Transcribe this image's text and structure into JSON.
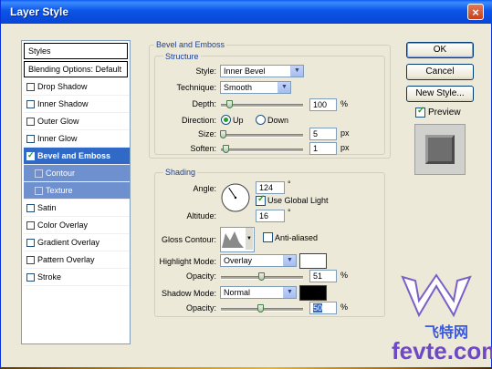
{
  "window": {
    "title": "Layer Style"
  },
  "styles_panel": {
    "header": "Styles",
    "blending_options": "Blending Options: Default",
    "items": [
      {
        "label": "Drop Shadow",
        "checked": false
      },
      {
        "label": "Inner Shadow",
        "checked": false
      },
      {
        "label": "Outer Glow",
        "checked": false
      },
      {
        "label": "Inner Glow",
        "checked": false
      },
      {
        "label": "Bevel and Emboss",
        "checked": true,
        "selected": true
      },
      {
        "label": "Contour",
        "checked": false,
        "sub": true
      },
      {
        "label": "Texture",
        "checked": false,
        "sub": true
      },
      {
        "label": "Satin",
        "checked": false
      },
      {
        "label": "Color Overlay",
        "checked": false
      },
      {
        "label": "Gradient Overlay",
        "checked": false
      },
      {
        "label": "Pattern Overlay",
        "checked": false
      },
      {
        "label": "Stroke",
        "checked": false
      }
    ]
  },
  "bevel": {
    "group_title": "Bevel and Emboss",
    "structure_title": "Structure",
    "style_label": "Style:",
    "style_value": "Inner Bevel",
    "technique_label": "Technique:",
    "technique_value": "Smooth",
    "depth_label": "Depth:",
    "depth_value": "100",
    "depth_unit": "%",
    "direction_label": "Direction:",
    "direction_up": "Up",
    "direction_down": "Down",
    "direction_selected": "Up",
    "size_label": "Size:",
    "size_value": "5",
    "size_unit": "px",
    "soften_label": "Soften:",
    "soften_value": "1",
    "soften_unit": "px"
  },
  "shading": {
    "title": "Shading",
    "angle_label": "Angle:",
    "angle_value": "124",
    "angle_unit": "°",
    "use_global_light": "Use Global Light",
    "use_global_light_checked": true,
    "altitude_label": "Altitude:",
    "altitude_value": "16",
    "altitude_unit": "°",
    "gloss_contour_label": "Gloss Contour:",
    "anti_aliased": "Anti-aliased",
    "anti_aliased_checked": false,
    "highlight_mode_label": "Highlight Mode:",
    "highlight_mode_value": "Overlay",
    "highlight_color": "#ffffff",
    "h_opacity_label": "Opacity:",
    "h_opacity_value": "51",
    "h_opacity_unit": "%",
    "shadow_mode_label": "Shadow Mode:",
    "shadow_mode_value": "Normal",
    "shadow_color": "#000000",
    "s_opacity_label": "Opacity:",
    "s_opacity_value": "50",
    "s_opacity_unit": "%"
  },
  "buttons": {
    "ok": "OK",
    "cancel": "Cancel",
    "new_style": "New Style...",
    "preview": "Preview",
    "preview_checked": true
  },
  "watermark": {
    "chinese": "飞特网",
    "site": "fevte.com"
  }
}
